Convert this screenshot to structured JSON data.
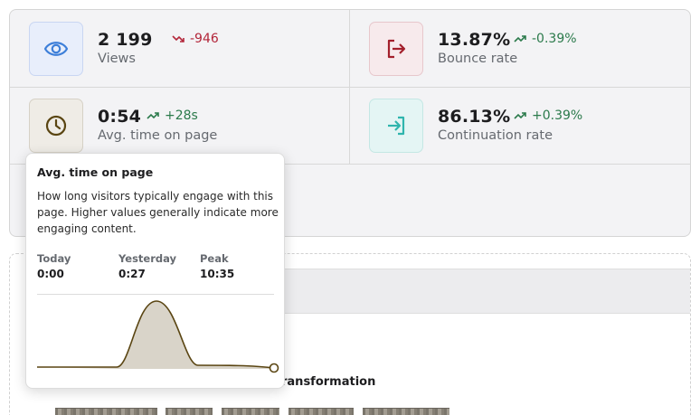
{
  "metrics": {
    "views": {
      "value": "2 199",
      "delta": "-946",
      "label": "Views",
      "trend": "down",
      "icon": "eye-icon",
      "color": "#3d7fd9"
    },
    "bounce": {
      "value": "13.87%",
      "delta": "-0.39%",
      "label": "Bounce rate",
      "trend": "up",
      "icon": "exit-icon",
      "color": "#a3202c"
    },
    "time": {
      "value": "0:54",
      "delta": "+28s",
      "label": "Avg. time on page",
      "trend": "up",
      "icon": "clock-icon",
      "color": "#5a4512"
    },
    "continuation": {
      "value": "86.13%",
      "delta": "+0.39%",
      "label": "Continuation rate",
      "trend": "up",
      "icon": "enter-icon",
      "color": "#2fb5ad"
    }
  },
  "tooltip": {
    "title": "Avg. time on page",
    "description": "How long visitors typically engage with this page. Higher values generally indicate more engaging content.",
    "stats": [
      {
        "label": "Today",
        "value": "0:00"
      },
      {
        "label": "Yesterday",
        "value": "0:27"
      },
      {
        "label": "Peak",
        "value": "10:35"
      }
    ]
  },
  "content": {
    "heading_fragment": "ransformation"
  },
  "colors": {
    "positive": "#2b7a4b",
    "negative": "#b3263a",
    "sparkline_stroke": "#5a4512",
    "sparkline_fill": "#d9d4c9"
  }
}
